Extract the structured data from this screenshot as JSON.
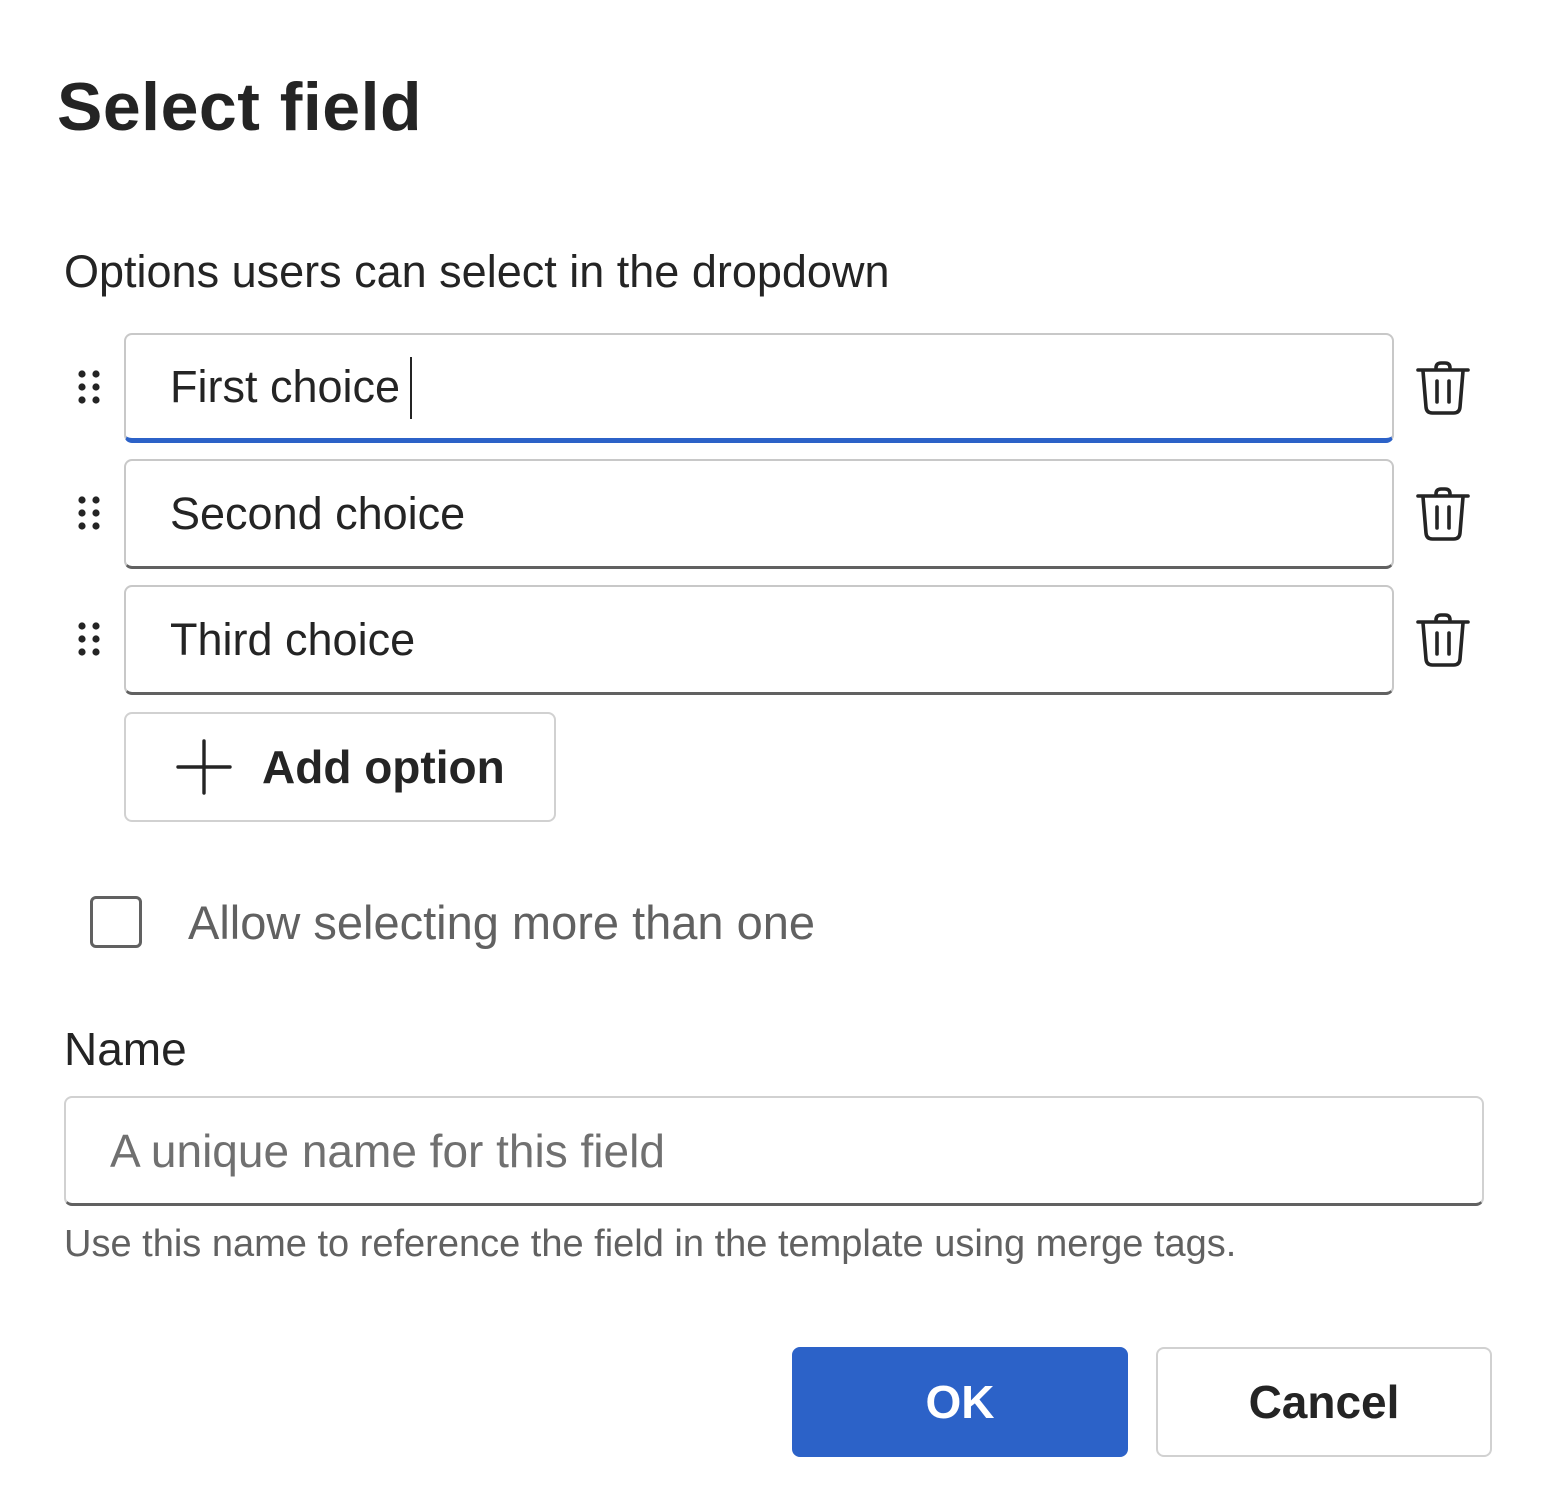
{
  "dialog": {
    "title": "Select field",
    "options_label": "Options users can select in the dropdown",
    "options": [
      {
        "value": "First choice",
        "focused": true
      },
      {
        "value": "Second choice",
        "focused": false
      },
      {
        "value": "Third choice",
        "focused": false
      }
    ],
    "add_option_label": "Add option",
    "multi_select": {
      "label": "Allow selecting more than one",
      "checked": false
    },
    "name_field": {
      "label": "Name",
      "value": "",
      "placeholder": "A unique name for this field",
      "helper": "Use this name to reference the field in the template using merge tags."
    },
    "buttons": {
      "ok_label": "OK",
      "cancel_label": "Cancel"
    }
  },
  "colors": {
    "accent": "#2c62c8",
    "text": "#242424",
    "muted_text": "#616161",
    "border": "#d1d1d1"
  },
  "icons": {
    "drag": "drag-handle-icon",
    "delete": "trash-icon",
    "add": "plus-icon"
  }
}
